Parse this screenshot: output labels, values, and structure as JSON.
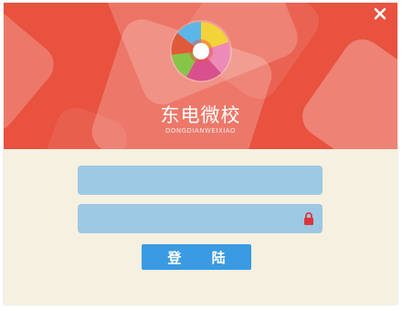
{
  "header": {
    "app_name": "东电微校",
    "app_subtitle": "DONGDIANWEIXIAO",
    "logo_icon": "pinwheel-logo-icon",
    "close_icon": "close-icon",
    "background_color": "#e8523f"
  },
  "form": {
    "username": {
      "value": "",
      "placeholder": ""
    },
    "password": {
      "value": "",
      "placeholder": "",
      "icon": "lock-icon",
      "icon_color": "#d9373b"
    },
    "field_color": "#9dc8e3",
    "login_label": "登 陆",
    "login_color": "#3a9ae2"
  },
  "window": {
    "background_color": "#f6f0e0"
  }
}
